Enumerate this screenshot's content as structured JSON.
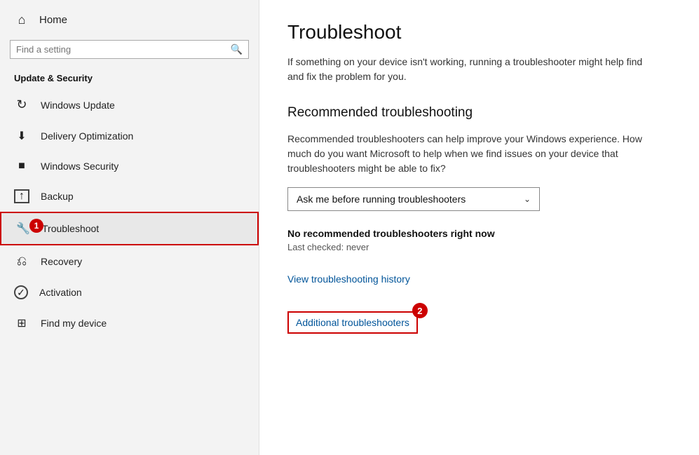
{
  "sidebar": {
    "home_label": "Home",
    "search_placeholder": "Find a setting",
    "section_label": "Update & Security",
    "nav_items": [
      {
        "id": "windows-update",
        "label": "Windows Update",
        "icon": "update"
      },
      {
        "id": "delivery-optimization",
        "label": "Delivery Optimization",
        "icon": "delivery"
      },
      {
        "id": "windows-security",
        "label": "Windows Security",
        "icon": "security"
      },
      {
        "id": "backup",
        "label": "Backup",
        "icon": "backup"
      },
      {
        "id": "troubleshoot",
        "label": "Troubleshoot",
        "icon": "troubleshoot",
        "active": true,
        "badge": "1"
      },
      {
        "id": "recovery",
        "label": "Recovery",
        "icon": "recovery"
      },
      {
        "id": "activation",
        "label": "Activation",
        "icon": "activation"
      },
      {
        "id": "find-my-device",
        "label": "Find my device",
        "icon": "find"
      }
    ]
  },
  "main": {
    "page_title": "Troubleshoot",
    "intro_text": "If something on your device isn't working, running a troubleshooter might help find and fix the problem for you.",
    "recommended_section_title": "Recommended troubleshooting",
    "recommended_desc": "Recommended troubleshooters can help improve your Windows experience. How much do you want Microsoft to help when we find issues on your device that troubleshooters might be able to fix?",
    "dropdown_value": "Ask me before running troubleshooters",
    "no_recommended_text": "No recommended troubleshooters right now",
    "last_checked_text": "Last checked: never",
    "view_history_link": "View troubleshooting history",
    "additional_link": "Additional troubleshooters",
    "additional_badge": "2"
  }
}
